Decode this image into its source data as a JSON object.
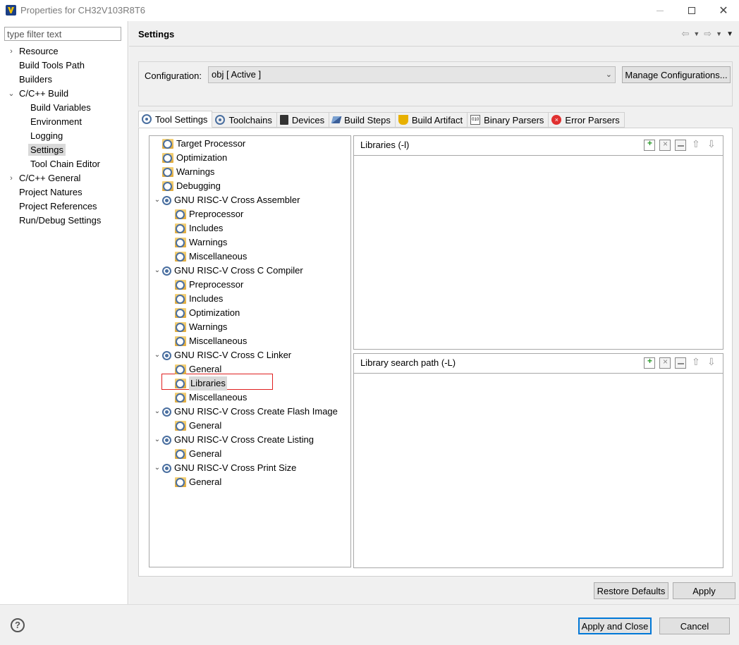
{
  "window": {
    "title": "Properties for CH32V103R8T6"
  },
  "filter": {
    "placeholder": "type filter text"
  },
  "nav": [
    {
      "label": "Resource",
      "depth": 0,
      "arrow": "›"
    },
    {
      "label": "Build Tools Path",
      "depth": 0,
      "arrow": ""
    },
    {
      "label": "Builders",
      "depth": 0,
      "arrow": ""
    },
    {
      "label": "C/C++ Build",
      "depth": 0,
      "arrow": "⌄"
    },
    {
      "label": "Build Variables",
      "depth": 1,
      "arrow": ""
    },
    {
      "label": "Environment",
      "depth": 1,
      "arrow": ""
    },
    {
      "label": "Logging",
      "depth": 1,
      "arrow": ""
    },
    {
      "label": "Settings",
      "depth": 1,
      "arrow": "",
      "selected": true
    },
    {
      "label": "Tool Chain Editor",
      "depth": 1,
      "arrow": ""
    },
    {
      "label": "C/C++ General",
      "depth": 0,
      "arrow": "›"
    },
    {
      "label": "Project Natures",
      "depth": 0,
      "arrow": ""
    },
    {
      "label": "Project References",
      "depth": 0,
      "arrow": ""
    },
    {
      "label": "Run/Debug Settings",
      "depth": 0,
      "arrow": ""
    }
  ],
  "header": {
    "title": "Settings",
    "back_icon": "back-arrow-icon",
    "forward_icon": "forward-arrow-icon",
    "menu_icon": "view-menu-icon"
  },
  "config": {
    "label": "Configuration:",
    "value": "obj  [ Active ]",
    "manage_label": "Manage Configurations..."
  },
  "tabs": [
    {
      "label": "Tool Settings",
      "icon": "gear",
      "active": true
    },
    {
      "label": "Toolchains",
      "icon": "gear"
    },
    {
      "label": "Devices",
      "icon": "chip"
    },
    {
      "label": "Build Steps",
      "icon": "steps"
    },
    {
      "label": "Build Artifact",
      "icon": "trophy"
    },
    {
      "label": "Binary Parsers",
      "icon": "binary"
    },
    {
      "label": "Error Parsers",
      "icon": "error"
    }
  ],
  "tree": [
    {
      "label": "Target Processor",
      "depth": 0,
      "type": "option"
    },
    {
      "label": "Optimization",
      "depth": 0,
      "type": "option"
    },
    {
      "label": "Warnings",
      "depth": 0,
      "type": "option"
    },
    {
      "label": "Debugging",
      "depth": 0,
      "type": "option"
    },
    {
      "label": "GNU RISC-V Cross Assembler",
      "depth": 0,
      "type": "tool"
    },
    {
      "label": "Preprocessor",
      "depth": 1,
      "type": "option"
    },
    {
      "label": "Includes",
      "depth": 1,
      "type": "option"
    },
    {
      "label": "Warnings",
      "depth": 1,
      "type": "option"
    },
    {
      "label": "Miscellaneous",
      "depth": 1,
      "type": "option"
    },
    {
      "label": "GNU RISC-V Cross C Compiler",
      "depth": 0,
      "type": "tool"
    },
    {
      "label": "Preprocessor",
      "depth": 1,
      "type": "option"
    },
    {
      "label": "Includes",
      "depth": 1,
      "type": "option"
    },
    {
      "label": "Optimization",
      "depth": 1,
      "type": "option"
    },
    {
      "label": "Warnings",
      "depth": 1,
      "type": "option"
    },
    {
      "label": "Miscellaneous",
      "depth": 1,
      "type": "option"
    },
    {
      "label": "GNU RISC-V Cross C Linker",
      "depth": 0,
      "type": "tool"
    },
    {
      "label": "General",
      "depth": 1,
      "type": "option"
    },
    {
      "label": "Libraries",
      "depth": 1,
      "type": "option",
      "selected": true
    },
    {
      "label": "Miscellaneous",
      "depth": 1,
      "type": "option"
    },
    {
      "label": "GNU RISC-V Cross Create Flash Image",
      "depth": 0,
      "type": "tool"
    },
    {
      "label": "General",
      "depth": 1,
      "type": "option"
    },
    {
      "label": "GNU RISC-V Cross Create Listing",
      "depth": 0,
      "type": "tool"
    },
    {
      "label": "General",
      "depth": 1,
      "type": "option"
    },
    {
      "label": "GNU RISC-V Cross Print Size",
      "depth": 0,
      "type": "tool"
    },
    {
      "label": "General",
      "depth": 1,
      "type": "option"
    }
  ],
  "libraries_panel": {
    "title": "Libraries (-l)"
  },
  "library_path_panel": {
    "title": "Library search path (-L)"
  },
  "buttons": {
    "restore_defaults": "Restore Defaults",
    "apply": "Apply",
    "apply_and_close": "Apply and Close",
    "cancel": "Cancel",
    "help": "?"
  },
  "colors": {
    "selection_highlight_border": "#e02020",
    "primary_button_border": "#0078d7"
  }
}
